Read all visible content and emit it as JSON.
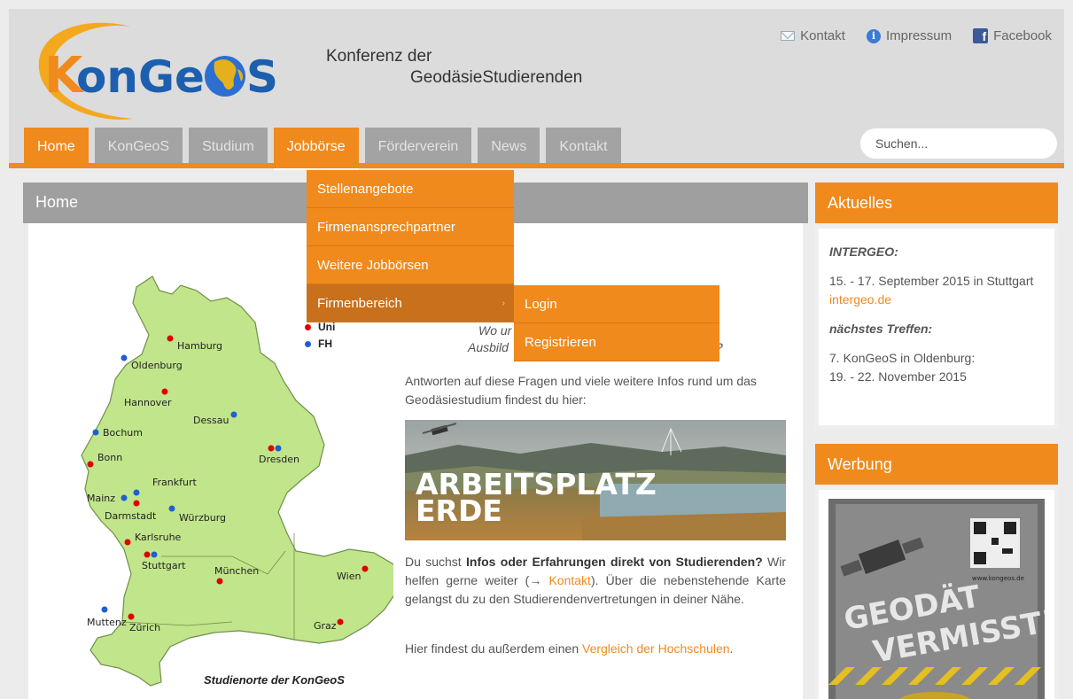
{
  "header": {
    "logo_text": "KonGeoS",
    "tagline_line1": "Konferenz der",
    "tagline_line2": "GeodäsieStudierenden",
    "top_links": {
      "contact": "Kontakt",
      "imprint": "Impressum",
      "facebook": "Facebook"
    }
  },
  "nav": {
    "items": [
      "Home",
      "KonGeoS",
      "Studium",
      "Jobbörse",
      "Förderverein",
      "News",
      "Kontakt"
    ],
    "active": "Home",
    "open": "Jobbörse"
  },
  "search": {
    "placeholder": "Suchen..."
  },
  "dropdown": {
    "items": [
      "Stellenangebote",
      "Firmenansprechpartner",
      "Weitere Jobbörsen",
      "Firmenbereich"
    ],
    "submenu_arrow": "›",
    "submenu": [
      "Login",
      "Registrieren"
    ]
  },
  "main": {
    "title": "Home",
    "question_partial_1": "Wo ur",
    "question_partial_2": "Ausbild",
    "question_partial_end": "?",
    "intro": "Antworten auf diese Fragen und viele weitere Infos rund um das Geodäsiestudium findest du hier:",
    "banner_line1": "ARBEITSPLATZ",
    "banner_line2": "ERDE",
    "desc_1": "Du suchst ",
    "desc_bold": "Infos oder Erfahrungen direkt von Studierenden?",
    "desc_2": " Wir helfen gerne weiter (→ ",
    "desc_link": "Kontakt",
    "desc_3": "). Über die nebenstehende Karte gelangst du zu den Studierendenvertretungen in deiner Nähe.",
    "compare_1": "Hier findest du außerdem einen ",
    "compare_link": "Vergleich der Hochschulen",
    "compare_2": "."
  },
  "map": {
    "legend_uni": "Uni",
    "legend_fh": "FH",
    "caption": "Studienorte der KonGeoS",
    "colors": {
      "uni": "#e00000",
      "fh": "#1f5fd0",
      "land": "#c1e58a"
    },
    "cities": {
      "hamburg": "Hamburg",
      "oldenburg": "Oldenburg",
      "hannover": "Hannover",
      "dessau": "Dessau",
      "bochum": "Bochum",
      "bonn": "Bonn",
      "dresden": "Dresden",
      "frankfurt": "Frankfurt",
      "mainz": "Mainz",
      "darmstadt": "Darmstadt",
      "wuerzburg": "Würzburg",
      "karlsruhe": "Karlsruhe",
      "stuttgart": "Stuttgart",
      "muenchen": "München",
      "wien": "Wien",
      "graz": "Graz",
      "muttenz": "Muttenz",
      "zuerich": "Zürich"
    }
  },
  "sidebar": {
    "news_title": "Aktuelles",
    "event1_title": "INTERGEO:",
    "event1_text": "15. - 17. September 2015 in Stuttgart",
    "event1_link": "intergeo.de",
    "event2_title": "nächstes Treffen:",
    "event2_line1": "7. KonGeoS in Oldenburg:",
    "event2_line2": "19. - 22. November 2015",
    "ad_title": "Werbung",
    "ad_text1": "GEODÄT",
    "ad_text2": "VERMISST!",
    "ad_url": "www.kongeos.de"
  },
  "colors": {
    "accent": "#f08a1c",
    "nav_inactive": "#a3a3a3",
    "header_bg": "#dcdcdc"
  }
}
